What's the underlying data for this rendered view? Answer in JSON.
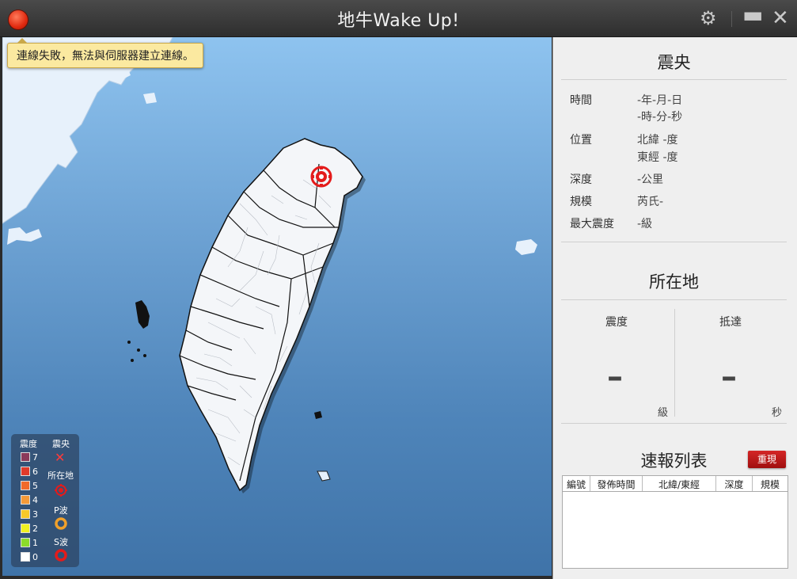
{
  "window": {
    "title": "地牛Wake Up!",
    "icons": {
      "close": "close-dot",
      "settings": "gear-icon",
      "minimize": "minimize-icon",
      "exit": "close-icon"
    }
  },
  "toast": {
    "message": "連線失敗，無法與伺服器建立連線。"
  },
  "legend": {
    "intensity_header": "震度",
    "epicenter_header": "震央",
    "location_label": "所在地",
    "p_wave_label": "P波",
    "s_wave_label": "S波",
    "levels": [
      {
        "label": "7",
        "color": "#8b3a5a"
      },
      {
        "label": "6",
        "color": "#e03a2a"
      },
      {
        "label": "5",
        "color": "#f06a2a"
      },
      {
        "label": "4",
        "color": "#f59a38"
      },
      {
        "label": "3",
        "color": "#f8c82a"
      },
      {
        "label": "2",
        "color": "#f0f020"
      },
      {
        "label": "1",
        "color": "#8cdc2a"
      },
      {
        "label": "0",
        "color": "#ffffff"
      }
    ]
  },
  "epicenter": {
    "title": "震央",
    "time_label": "時間",
    "date_value": "-年-月-日",
    "time_value": "-時-分-秒",
    "location_label": "位置",
    "lat_value": "北緯 -度",
    "lon_value": "東經 -度",
    "depth_label": "深度",
    "depth_value": "-公里",
    "magnitude_label": "規模",
    "magnitude_value": "芮氏-",
    "max_intensity_label": "最大震度",
    "max_intensity_value": "-級"
  },
  "local": {
    "title": "所在地",
    "intensity_label": "震度",
    "intensity_value": "–",
    "intensity_unit": "級",
    "arrival_label": "抵達",
    "arrival_value": "–",
    "arrival_unit": "秒"
  },
  "reports": {
    "title": "速報列表",
    "replay_button": "重現",
    "columns": [
      "編號",
      "發佈時間",
      "北緯/東經",
      "深度",
      "規模"
    ],
    "rows": []
  },
  "colors": {
    "accent_red": "#c0141c",
    "sea": "#5a8fc4",
    "land": "#f4f6f9"
  }
}
